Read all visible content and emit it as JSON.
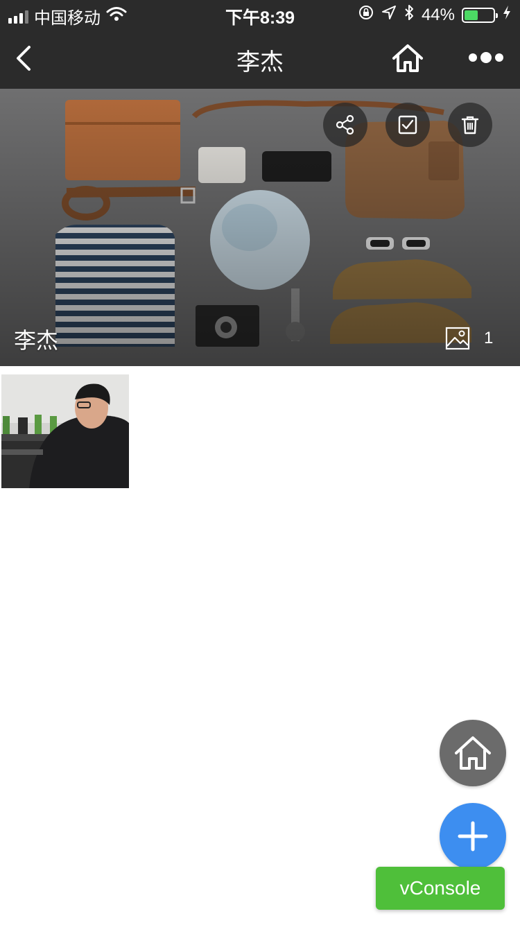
{
  "status_bar": {
    "carrier": "中国移动",
    "time": "下午8:39",
    "battery_percent": "44%",
    "battery_level": 0.44,
    "icons": [
      "signal-icon",
      "wifi-icon",
      "rotation-lock-icon",
      "location-icon",
      "bluetooth-icon",
      "battery-icon",
      "charging-icon"
    ]
  },
  "nav": {
    "title": "李杰",
    "icons": [
      "back-chevron-icon",
      "home-icon",
      "more-dots-icon"
    ]
  },
  "cover": {
    "title": "李杰",
    "photo_count": "1",
    "actions": [
      "share-icon",
      "checkbox-icon",
      "trash-icon"
    ]
  },
  "photos": [
    {
      "icon": "photo-thumbnail"
    }
  ],
  "floating": {
    "home_icon": "home-icon",
    "add_icon": "plus-icon",
    "vconsole_label": "vConsole"
  },
  "colors": {
    "bar_background": "#2b2b2b",
    "fab_home": "#6b6b6b",
    "fab_add": "#3d8ef0",
    "vconsole": "#4fbf3a",
    "battery_fill": "#4cd964"
  }
}
